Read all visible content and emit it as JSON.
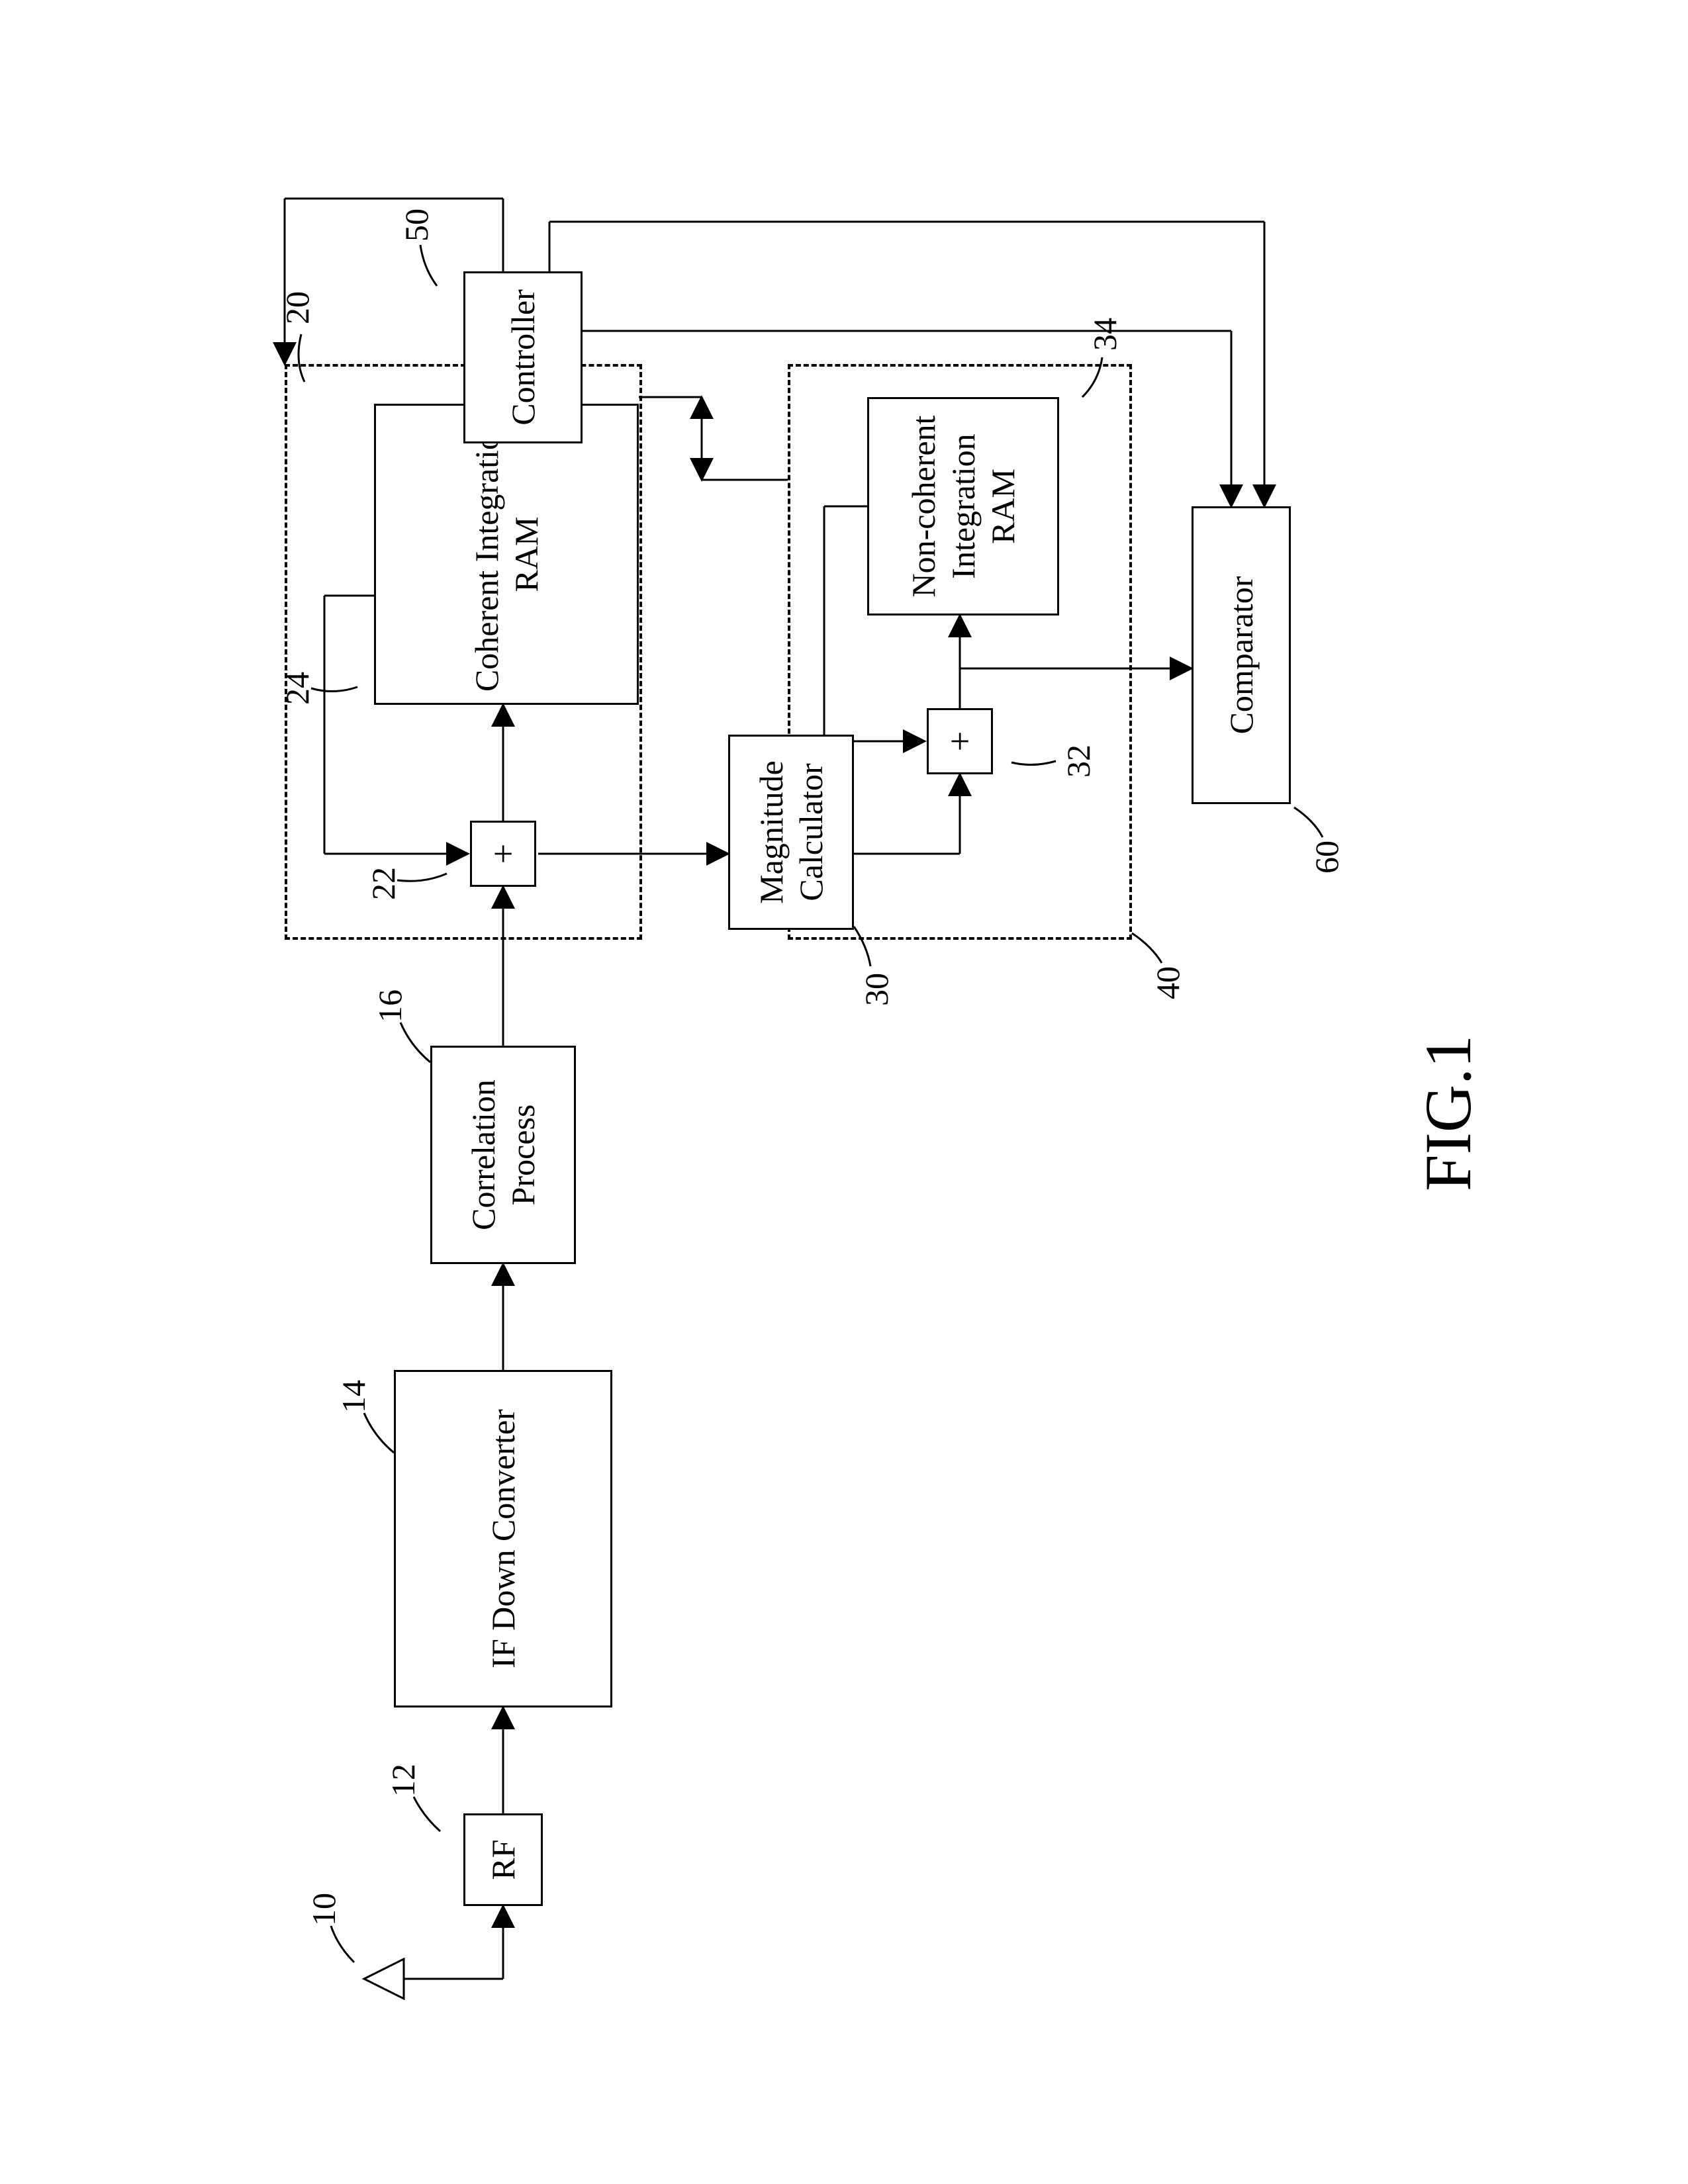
{
  "figure_label": "FIG.1",
  "blocks": {
    "rf": "RF",
    "ifdc": "IF Down Converter",
    "corr": "Correlation Process",
    "cohRam": "Coherent Integration RAM",
    "mag": "Magnitude Calculator",
    "ncRam": "Non-coherent Integration RAM",
    "controller": "Controller",
    "comparator": "Comparator"
  },
  "adders": {
    "plus1": "+",
    "plus2": "+"
  },
  "refs": {
    "r10": "10",
    "r12": "12",
    "r14": "14",
    "r16": "16",
    "r20": "20",
    "r22": "22",
    "r24": "24",
    "r30": "30",
    "r32": "32",
    "r34": "34",
    "r40": "40",
    "r50": "50",
    "r60": "60"
  }
}
